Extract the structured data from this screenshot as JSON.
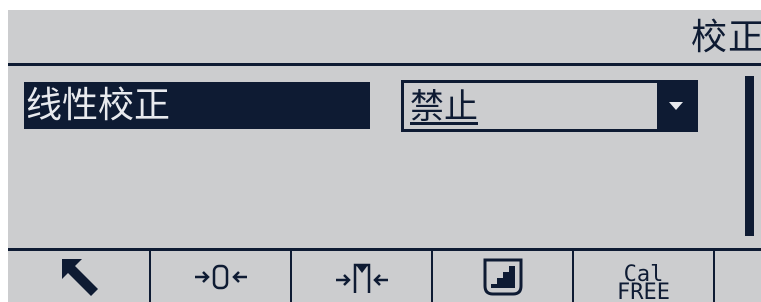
{
  "header": {
    "title": "校正"
  },
  "settings": {
    "field_label": "线性校正",
    "field_value": "禁止"
  },
  "softkeys": [
    {
      "icon": "escape-arrow-icon"
    },
    {
      "icon": "zero-icon"
    },
    {
      "icon": "tare-icon"
    },
    {
      "icon": "print-icon"
    },
    {
      "icon": "cal-free-icon",
      "label_line1": "Cal",
      "label_line2": "FREE"
    }
  ],
  "colors": {
    "screen_background": "#cccdcf",
    "foreground": "#0e1b33",
    "highlight_text": "#e8eaee"
  }
}
